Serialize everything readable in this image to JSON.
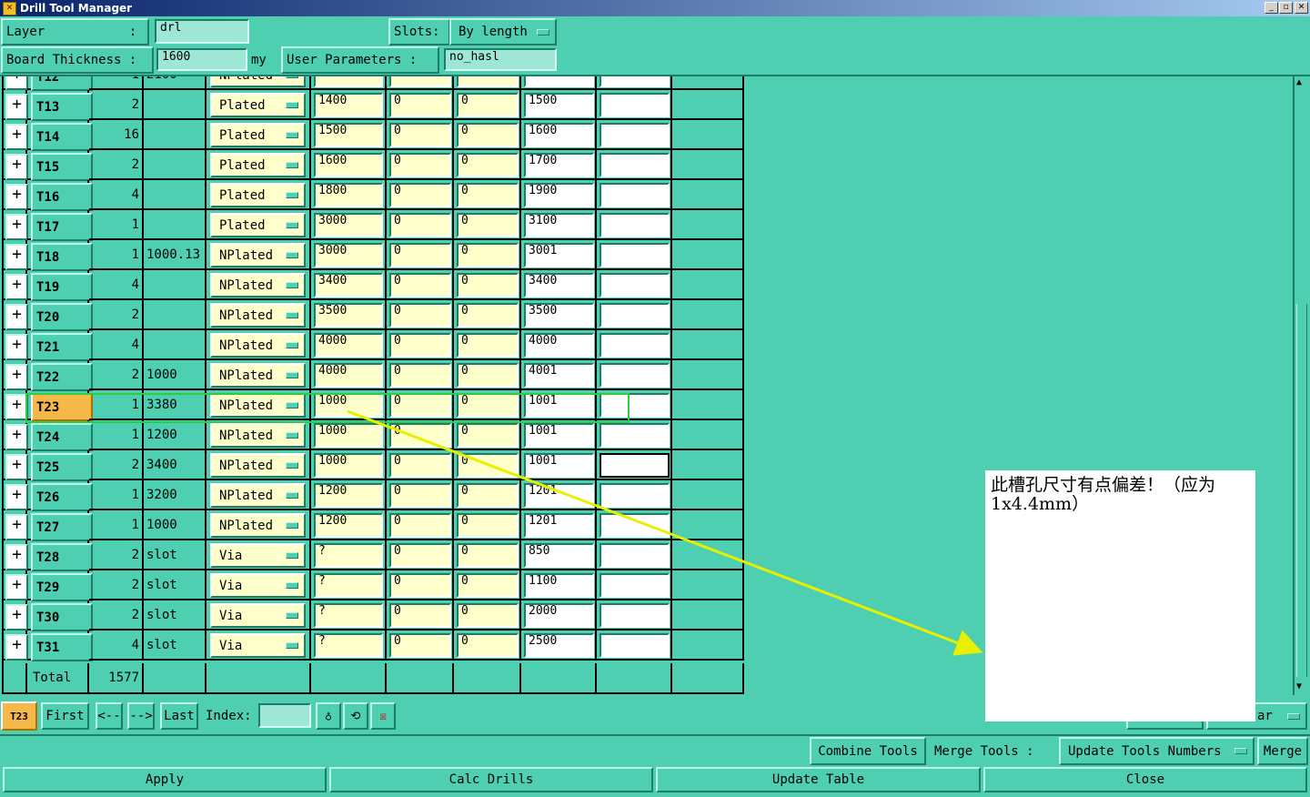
{
  "window": {
    "title": "Drill Tool Manager"
  },
  "header": {
    "layer_label": "Layer           :",
    "layer_value": "drl",
    "slots_label": "Slots:",
    "slots_value": "By length",
    "thickness_label": "Board Thickness :",
    "thickness_value": "1600",
    "thickness_unit": "my",
    "user_params_label": "User Parameters :",
    "user_params_value": "no_hasl"
  },
  "partial_row": {
    "tool": "T12",
    "count": "1",
    "size": "2100",
    "type": "NPlated"
  },
  "rows": [
    {
      "tool": "T13",
      "icon": "+",
      "count": "2",
      "size": "",
      "type": "Plated",
      "c1": "1400",
      "c2": "0",
      "c3": "0",
      "c4": "1500",
      "c5": ""
    },
    {
      "tool": "T14",
      "icon": "+",
      "count": "16",
      "size": "",
      "type": "Plated",
      "c1": "1500",
      "c2": "0",
      "c3": "0",
      "c4": "1600",
      "c5": ""
    },
    {
      "tool": "T15",
      "icon": "+",
      "count": "2",
      "size": "",
      "type": "Plated",
      "c1": "1600",
      "c2": "0",
      "c3": "0",
      "c4": "1700",
      "c5": ""
    },
    {
      "tool": "T16",
      "icon": "+",
      "count": "4",
      "size": "",
      "type": "Plated",
      "c1": "1800",
      "c2": "0",
      "c3": "0",
      "c4": "1900",
      "c5": ""
    },
    {
      "tool": "T17",
      "icon": "+",
      "count": "1",
      "size": "",
      "type": "Plated",
      "c1": "3000",
      "c2": "0",
      "c3": "0",
      "c4": "3100",
      "c5": ""
    },
    {
      "tool": "T18",
      "icon": "+",
      "count": "1",
      "size": "1000.13",
      "type": "NPlated",
      "c1": "3000",
      "c2": "0",
      "c3": "0",
      "c4": "3001",
      "c5": ""
    },
    {
      "tool": "T19",
      "icon": "+",
      "count": "4",
      "size": "",
      "type": "NPlated",
      "c1": "3400",
      "c2": "0",
      "c3": "0",
      "c4": "3400",
      "c5": ""
    },
    {
      "tool": "T20",
      "icon": "+",
      "count": "2",
      "size": "",
      "type": "NPlated",
      "c1": "3500",
      "c2": "0",
      "c3": "0",
      "c4": "3500",
      "c5": ""
    },
    {
      "tool": "T21",
      "icon": "+",
      "count": "4",
      "size": "",
      "type": "NPlated",
      "c1": "4000",
      "c2": "0",
      "c3": "0",
      "c4": "4000",
      "c5": ""
    },
    {
      "tool": "T22",
      "icon": "+",
      "count": "2",
      "size": "1000",
      "type": "NPlated",
      "c1": "4000",
      "c2": "0",
      "c3": "0",
      "c4": "4001",
      "c5": ""
    },
    {
      "tool": "T23",
      "icon": "+",
      "count": "1",
      "size": "3380",
      "type": "NPlated",
      "c1": "1000",
      "c2": "0",
      "c3": "0",
      "c4": "1001",
      "c5": ""
    },
    {
      "tool": "T24",
      "icon": "+",
      "count": "1",
      "size": "1200",
      "type": "NPlated",
      "c1": "1000",
      "c2": "0",
      "c3": "0",
      "c4": "1001",
      "c5": ""
    },
    {
      "tool": "T25",
      "icon": "+",
      "count": "2",
      "size": "3400",
      "type": "NPlated",
      "c1": "1000",
      "c2": "0",
      "c3": "0",
      "c4": "1001",
      "c5": ""
    },
    {
      "tool": "T26",
      "icon": "+",
      "count": "1",
      "size": "3200",
      "type": "NPlated",
      "c1": "1200",
      "c2": "0",
      "c3": "0",
      "c4": "1201",
      "c5": ""
    },
    {
      "tool": "T27",
      "icon": "+",
      "count": "1",
      "size": "1000",
      "type": "NPlated",
      "c1": "1200",
      "c2": "0",
      "c3": "0",
      "c4": "1201",
      "c5": ""
    },
    {
      "tool": "T28",
      "icon": "+",
      "count": "2",
      "size": "slot",
      "type": "Via",
      "c1": "?",
      "c2": "0",
      "c3": "0",
      "c4": "850",
      "c5": ""
    },
    {
      "tool": "T29",
      "icon": "+",
      "count": "2",
      "size": "slot",
      "type": "Via",
      "c1": "?",
      "c2": "0",
      "c3": "0",
      "c4": "1100",
      "c5": ""
    },
    {
      "tool": "T30",
      "icon": "+",
      "count": "2",
      "size": "slot",
      "type": "Via",
      "c1": "?",
      "c2": "0",
      "c3": "0",
      "c4": "2000",
      "c5": ""
    },
    {
      "tool": "T31",
      "icon": "+",
      "count": "4",
      "size": "slot",
      "type": "Via",
      "c1": "?",
      "c2": "0",
      "c3": "0",
      "c4": "2500",
      "c5": ""
    }
  ],
  "total": {
    "label": "Total",
    "count": "1577"
  },
  "nav": {
    "current": "T23",
    "first": "First",
    "prev": "<--",
    "next": "-->",
    "last": "Last",
    "index_label": "Index:",
    "index_value": "",
    "hidden_right_b": "ar"
  },
  "actions": {
    "combine": "Combine Tools",
    "merge_label": "Merge Tools :",
    "merge_option": "Update Tools Numbers",
    "merge": "Merge",
    "apply": "Apply",
    "calc": "Calc Drills",
    "update": "Update Table",
    "close": "Close"
  },
  "annotation": {
    "text": "此槽孔尺寸有点偏差！（应为1x4.4mm）"
  },
  "colors": {
    "background": "#4ecfb1",
    "input_yellow": "#ffffcc",
    "highlight_orange": "#f7b84a",
    "highlight_box": "#2ecc40",
    "arrow": "#e8f000"
  }
}
